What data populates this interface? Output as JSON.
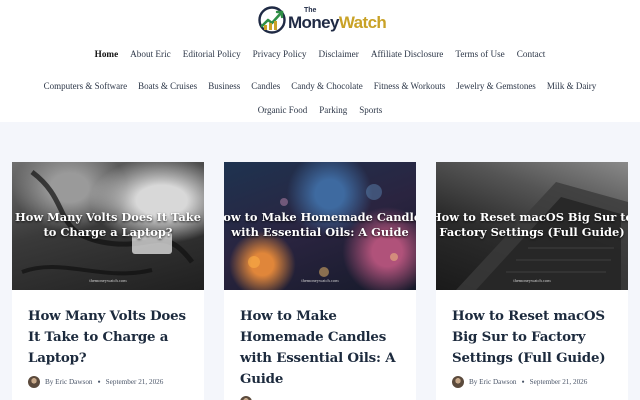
{
  "logo": {
    "the": "The",
    "money": "Money",
    "watch": "Watch"
  },
  "nav": {
    "primary": [
      "Home",
      "About Eric",
      "Editorial Policy",
      "Privacy Policy",
      "Disclaimer",
      "Affiliate Disclosure",
      "Terms of Use",
      "Contact"
    ],
    "categories_row1": [
      "Computers & Software",
      "Boats & Cruises",
      "Business",
      "Candles",
      "Candy & Chocolate",
      "Fitness & Workouts",
      "Jewelry & Gemstones",
      "Milk & Dairy"
    ],
    "categories_row2": [
      "Organic Food",
      "Parking",
      "Sports"
    ]
  },
  "articles": [
    {
      "thumb_lines": [
        "How Many Volts Does It Take",
        "to Charge a Laptop?"
      ],
      "thumb_brand": "themoneywatch.com",
      "title": "How Many Volts Does It Take to Charge a Laptop?",
      "author": "By Eric Dawson",
      "date": "September 21, 2026"
    },
    {
      "thumb_lines": [
        "How to Make Homemade Candles",
        "with Essential Oils: A Guide"
      ],
      "thumb_brand": "themoneywatch.com",
      "title": "How to Make Homemade Candles with Essential Oils: A Guide",
      "author": "",
      "date": ""
    },
    {
      "thumb_lines": [
        "How to Reset macOS Big Sur to",
        "Factory Settings (Full Guide)"
      ],
      "thumb_brand": "themoneywatch.com",
      "title": "How to Reset macOS Big Sur to Factory Settings (Full Guide)",
      "author": "By Eric Dawson",
      "date": "September 21, 2026"
    }
  ],
  "colors": {
    "page_bg": "#f4f6fb",
    "title": "#1c2a3d",
    "brand_gold": "#c9a227",
    "brand_navy": "#1f2a44"
  }
}
